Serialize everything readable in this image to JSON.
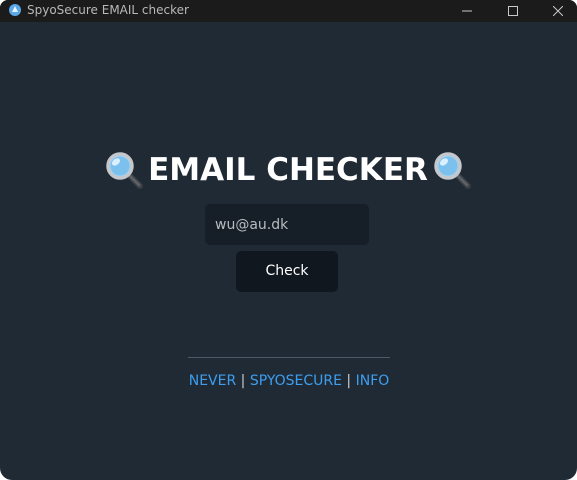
{
  "window": {
    "title": "SpyoSecure EMAIL checker",
    "controls": [
      "minimize",
      "maximize",
      "close"
    ]
  },
  "main": {
    "heading": "EMAIL CHECKER",
    "heading_icons": [
      "magnifying-glass-icon",
      "magnifying-glass-icon"
    ],
    "email_input": {
      "value": "wu@au.dk",
      "placeholder": ""
    },
    "check_button_label": "Check"
  },
  "footer": {
    "links": [
      {
        "label": "NEVER"
      },
      {
        "label": "SPYOSECURE"
      },
      {
        "label": "INFO"
      }
    ],
    "separator": "|"
  },
  "colors": {
    "background": "#202a35",
    "titlebar": "#1b1b1b",
    "input_background": "#161e27",
    "button_background": "#10171f",
    "link": "#3d9ef0",
    "heading": "#ffffff"
  }
}
